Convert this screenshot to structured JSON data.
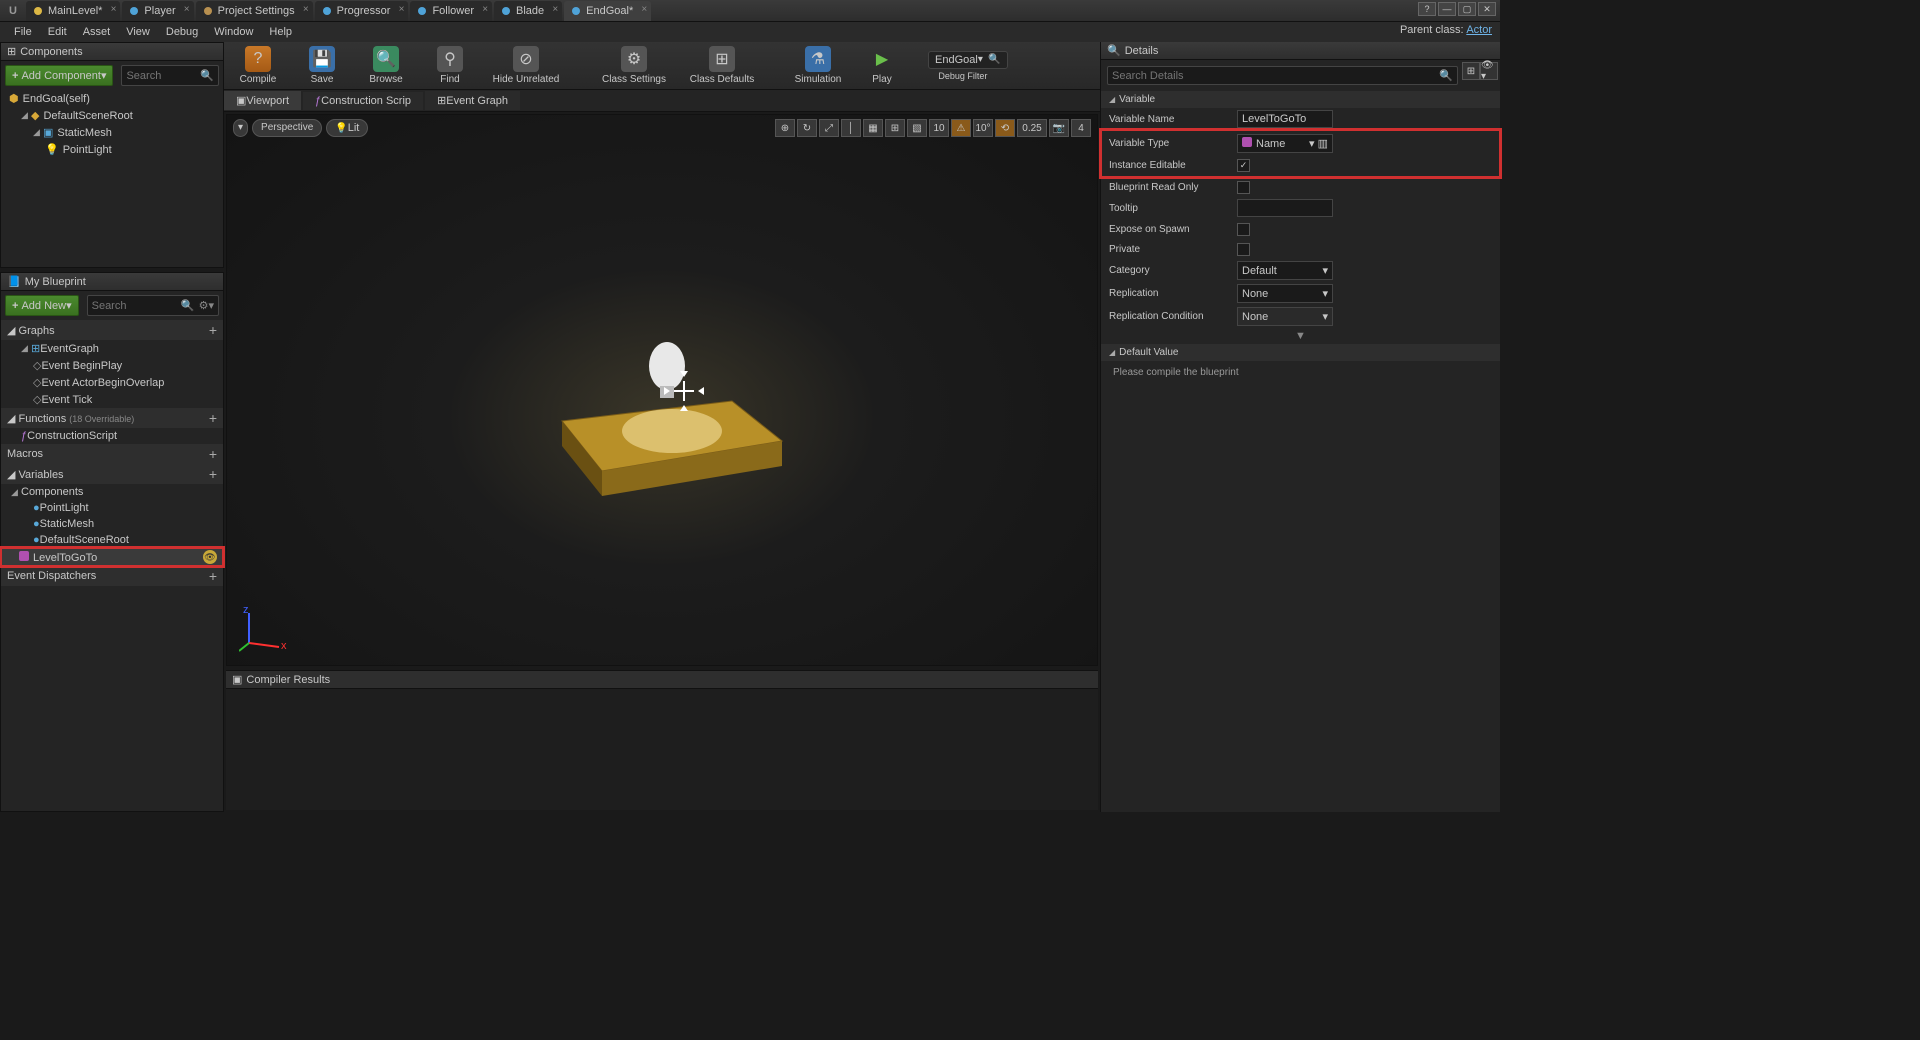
{
  "tabs": [
    {
      "label": "MainLevel*",
      "type": "map"
    },
    {
      "label": "Player",
      "type": "bp"
    },
    {
      "label": "Project Settings",
      "type": "ps"
    },
    {
      "label": "Progressor",
      "type": "bp"
    },
    {
      "label": "Follower",
      "type": "bp"
    },
    {
      "label": "Blade",
      "type": "bp"
    },
    {
      "label": "EndGoal*",
      "type": "bp",
      "active": true
    }
  ],
  "menu": [
    "File",
    "Edit",
    "Asset",
    "View",
    "Debug",
    "Window",
    "Help"
  ],
  "parentClassLabel": "Parent class:",
  "parentClass": "Actor",
  "toolbar": {
    "compile": "Compile",
    "save": "Save",
    "browse": "Browse",
    "find": "Find",
    "hide": "Hide Unrelated",
    "classSettings": "Class Settings",
    "classDefaults": "Class Defaults",
    "simulation": "Simulation",
    "play": "Play",
    "debugObj": "EndGoal",
    "debugFilter": "Debug Filter"
  },
  "components": {
    "title": "Components",
    "add": "Add Component",
    "searchPlaceholder": "Search",
    "root": "EndGoal(self)",
    "items": [
      "DefaultSceneRoot",
      "StaticMesh",
      "PointLight"
    ]
  },
  "myBlueprint": {
    "title": "My Blueprint",
    "add": "Add New",
    "searchPlaceholder": "Search",
    "graphs": {
      "title": "Graphs",
      "items": [
        "EventGraph",
        "Event BeginPlay",
        "Event ActorBeginOverlap",
        "Event Tick"
      ]
    },
    "functions": {
      "title": "Functions",
      "hint": "(18 Overridable)",
      "items": [
        "ConstructionScript"
      ]
    },
    "macros": {
      "title": "Macros"
    },
    "variables": {
      "title": "Variables",
      "componentsLabel": "Components",
      "components": [
        "PointLight",
        "StaticMesh",
        "DefaultSceneRoot"
      ],
      "user": [
        {
          "name": "LevelToGoTo",
          "color": "#b050b0",
          "eye": true,
          "highlight": true
        }
      ]
    },
    "dispatchers": {
      "title": "Event Dispatchers"
    }
  },
  "centerTabs": [
    "Viewport",
    "Construction Scrip",
    "Event Graph"
  ],
  "viewport": {
    "perspective": "Perspective",
    "lit": "Lit",
    "rightTools": [
      "⊕",
      "↻",
      "⤢",
      "│",
      "▦",
      "⊞",
      "▧",
      "10",
      "⚠",
      "10°",
      "⟲",
      "0.25",
      "📷",
      "4"
    ]
  },
  "compilerResults": "Compiler Results",
  "details": {
    "title": "Details",
    "searchPlaceholder": "Search Details",
    "variableCat": "Variable",
    "rows": {
      "varName": {
        "label": "Variable Name",
        "value": "LevelToGoTo"
      },
      "varType": {
        "label": "Variable Type",
        "value": "Name"
      },
      "instEdit": {
        "label": "Instance Editable",
        "checked": true
      },
      "readOnly": {
        "label": "Blueprint Read Only",
        "checked": false
      },
      "tooltip": {
        "label": "Tooltip",
        "value": ""
      },
      "expose": {
        "label": "Expose on Spawn",
        "checked": false
      },
      "private": {
        "label": "Private",
        "checked": false
      },
      "category": {
        "label": "Category",
        "value": "Default"
      },
      "replication": {
        "label": "Replication",
        "value": "None"
      },
      "repCond": {
        "label": "Replication Condition",
        "value": "None"
      }
    },
    "defaultValueCat": "Default Value",
    "defaultValueHint": "Please compile the blueprint"
  }
}
